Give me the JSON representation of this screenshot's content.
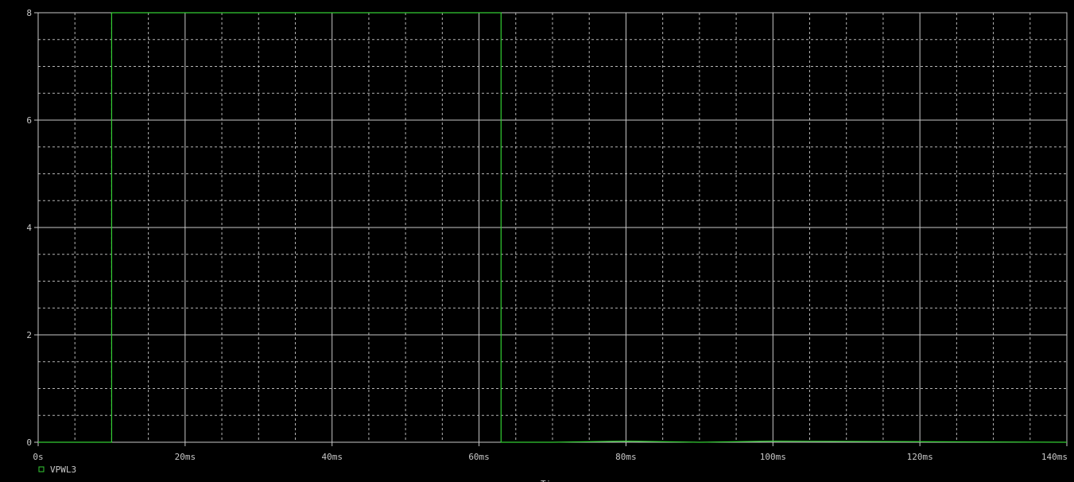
{
  "chart_data": {
    "type": "line",
    "title": "",
    "xlabel": "Ti",
    "ylabel": "",
    "xlim": [
      0,
      140
    ],
    "ylim": [
      0,
      8
    ],
    "x_unit": "ms",
    "x_ticks": [
      0,
      20,
      40,
      60,
      80,
      100,
      120,
      140
    ],
    "x_tick_labels": [
      "0s",
      "20ms",
      "40ms",
      "60ms",
      "80ms",
      "100ms",
      "120ms",
      "140ms"
    ],
    "y_ticks": [
      0,
      2,
      4,
      6,
      8
    ],
    "y_tick_labels": [
      "0",
      "2",
      "4",
      "6",
      "8"
    ],
    "x_minor_step": 5,
    "y_minor_step": 0.5,
    "grid": true,
    "legend_position": "bottom-left",
    "series": [
      {
        "name": "VPWL3",
        "color": "#33cc33",
        "x": [
          0,
          10,
          10,
          63,
          63,
          70,
          80,
          90,
          100,
          140
        ],
        "y": [
          0,
          0,
          8,
          8,
          0,
          0,
          0.02,
          0,
          0.02,
          0
        ]
      }
    ]
  },
  "colors": {
    "background": "#000000",
    "grid_major": "#c8c8c8",
    "grid_minor": "#b4b4b4",
    "trace": "#33cc33",
    "text": "#c8c8c8"
  }
}
